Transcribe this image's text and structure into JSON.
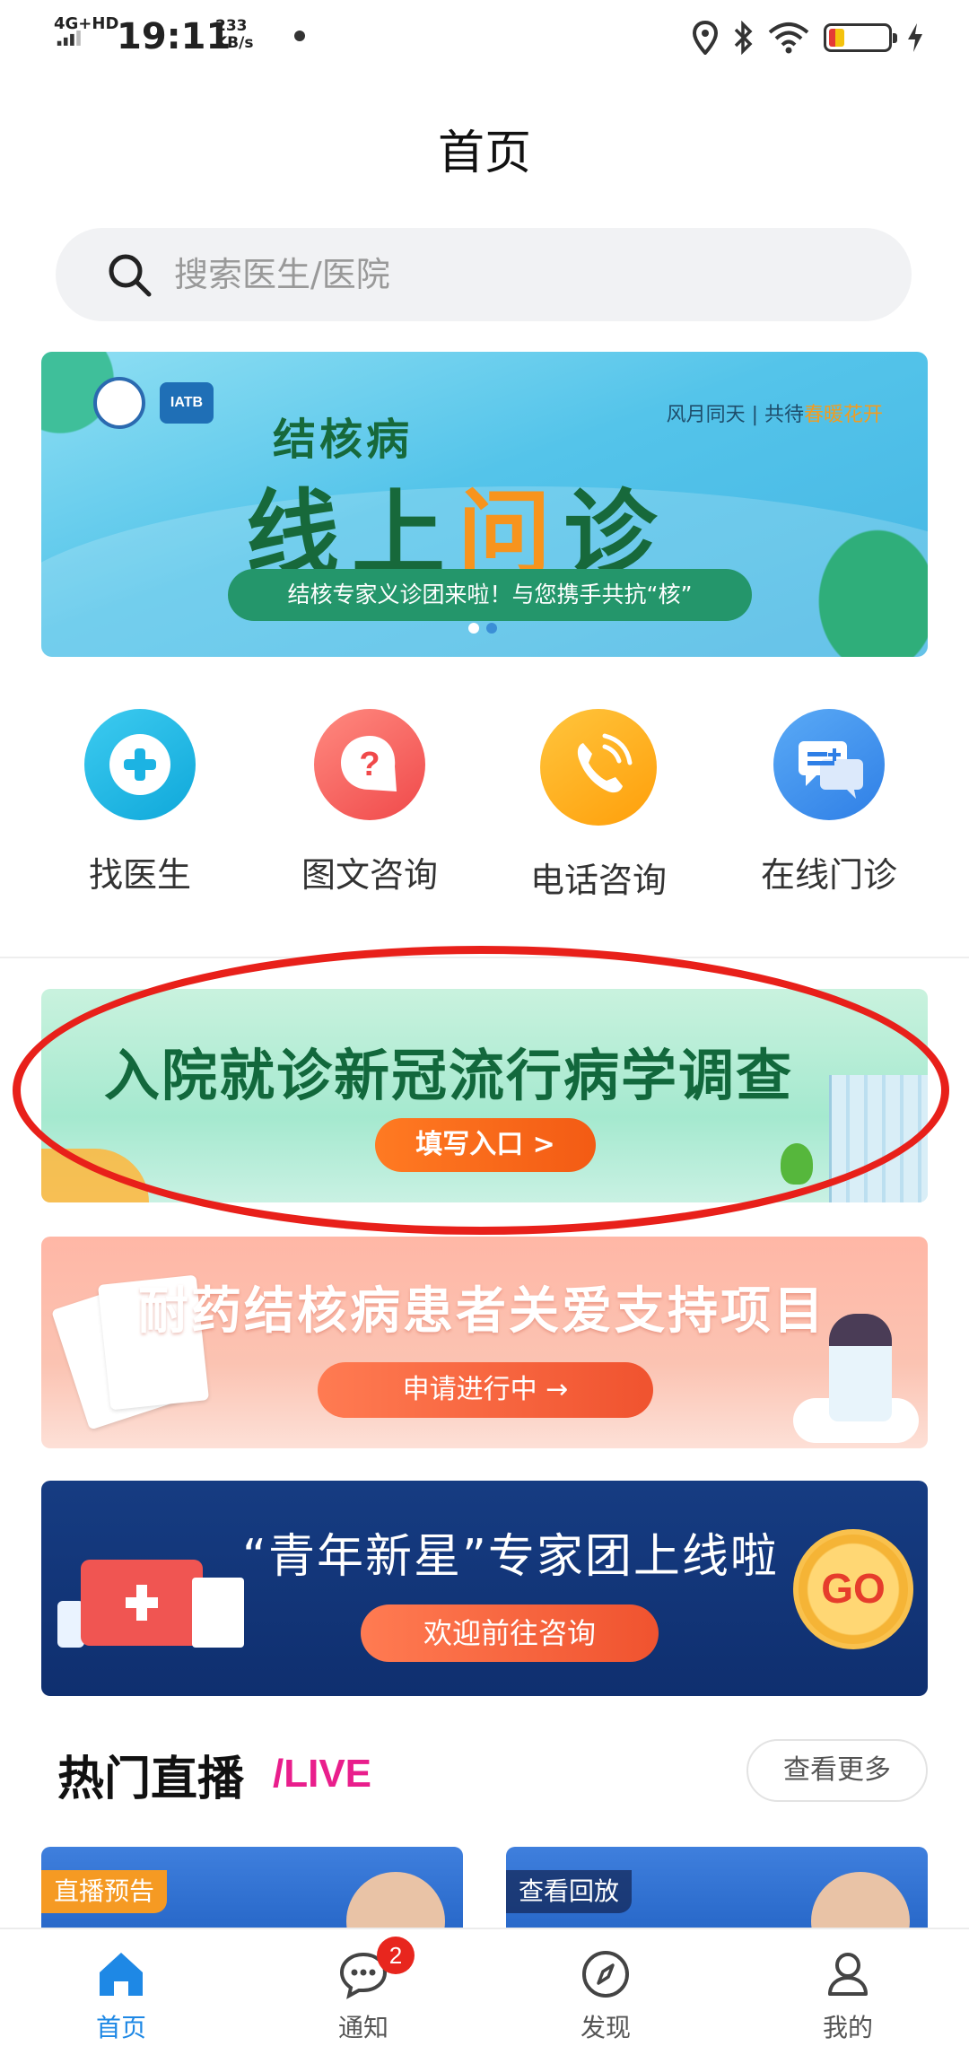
{
  "status_bar": {
    "network": "4G+HD",
    "time": "19:11",
    "speed_value": "233",
    "speed_unit": "KB/s"
  },
  "page_title": "首页",
  "search": {
    "placeholder": "搜索医生/医院"
  },
  "main_banner": {
    "logo_text": "IATB",
    "slogan_prefix": "风月同天 | 共待",
    "slogan_highlight": "春暖花开",
    "title_line1": "结核病",
    "title_line2_a": "线上",
    "title_line2_highlight": "问",
    "title_line2_b": "诊",
    "pill_text": "结核专家义诊团来啦！与您携手共抗“核”"
  },
  "quick_actions": [
    {
      "label": "找医生",
      "icon": "plus-icon"
    },
    {
      "label": "图文咨询",
      "icon": "question-bubble-icon"
    },
    {
      "label": "电话咨询",
      "icon": "phone-icon"
    },
    {
      "label": "在线门诊",
      "icon": "chat-bubbles-icon"
    }
  ],
  "survey_banner": {
    "title": "入院就诊新冠流行病学调查",
    "button": "填写入口 >"
  },
  "tb_banner": {
    "title": "耐药结核病患者关爱支持项目",
    "button": "申请进行中 →"
  },
  "expert_banner": {
    "title": "“青年新星”专家团上线啦",
    "button": "欢迎前往咨询",
    "go_badge": "GO"
  },
  "live_section": {
    "title": "热门直播",
    "subtitle": "/LIVE",
    "more": "查看更多",
    "cards": [
      {
        "tag": "直播预告"
      },
      {
        "tag": "查看回放"
      }
    ]
  },
  "bottom_nav": {
    "items": [
      {
        "label": "首页",
        "icon": "home-icon",
        "active": true
      },
      {
        "label": "通知",
        "icon": "message-icon",
        "badge": "2"
      },
      {
        "label": "发现",
        "icon": "compass-icon"
      },
      {
        "label": "我的",
        "icon": "user-icon"
      }
    ]
  },
  "colors": {
    "accent": "#1e88e5",
    "annotation": "#e8201a",
    "live_subtitle": "#e91e8c"
  }
}
